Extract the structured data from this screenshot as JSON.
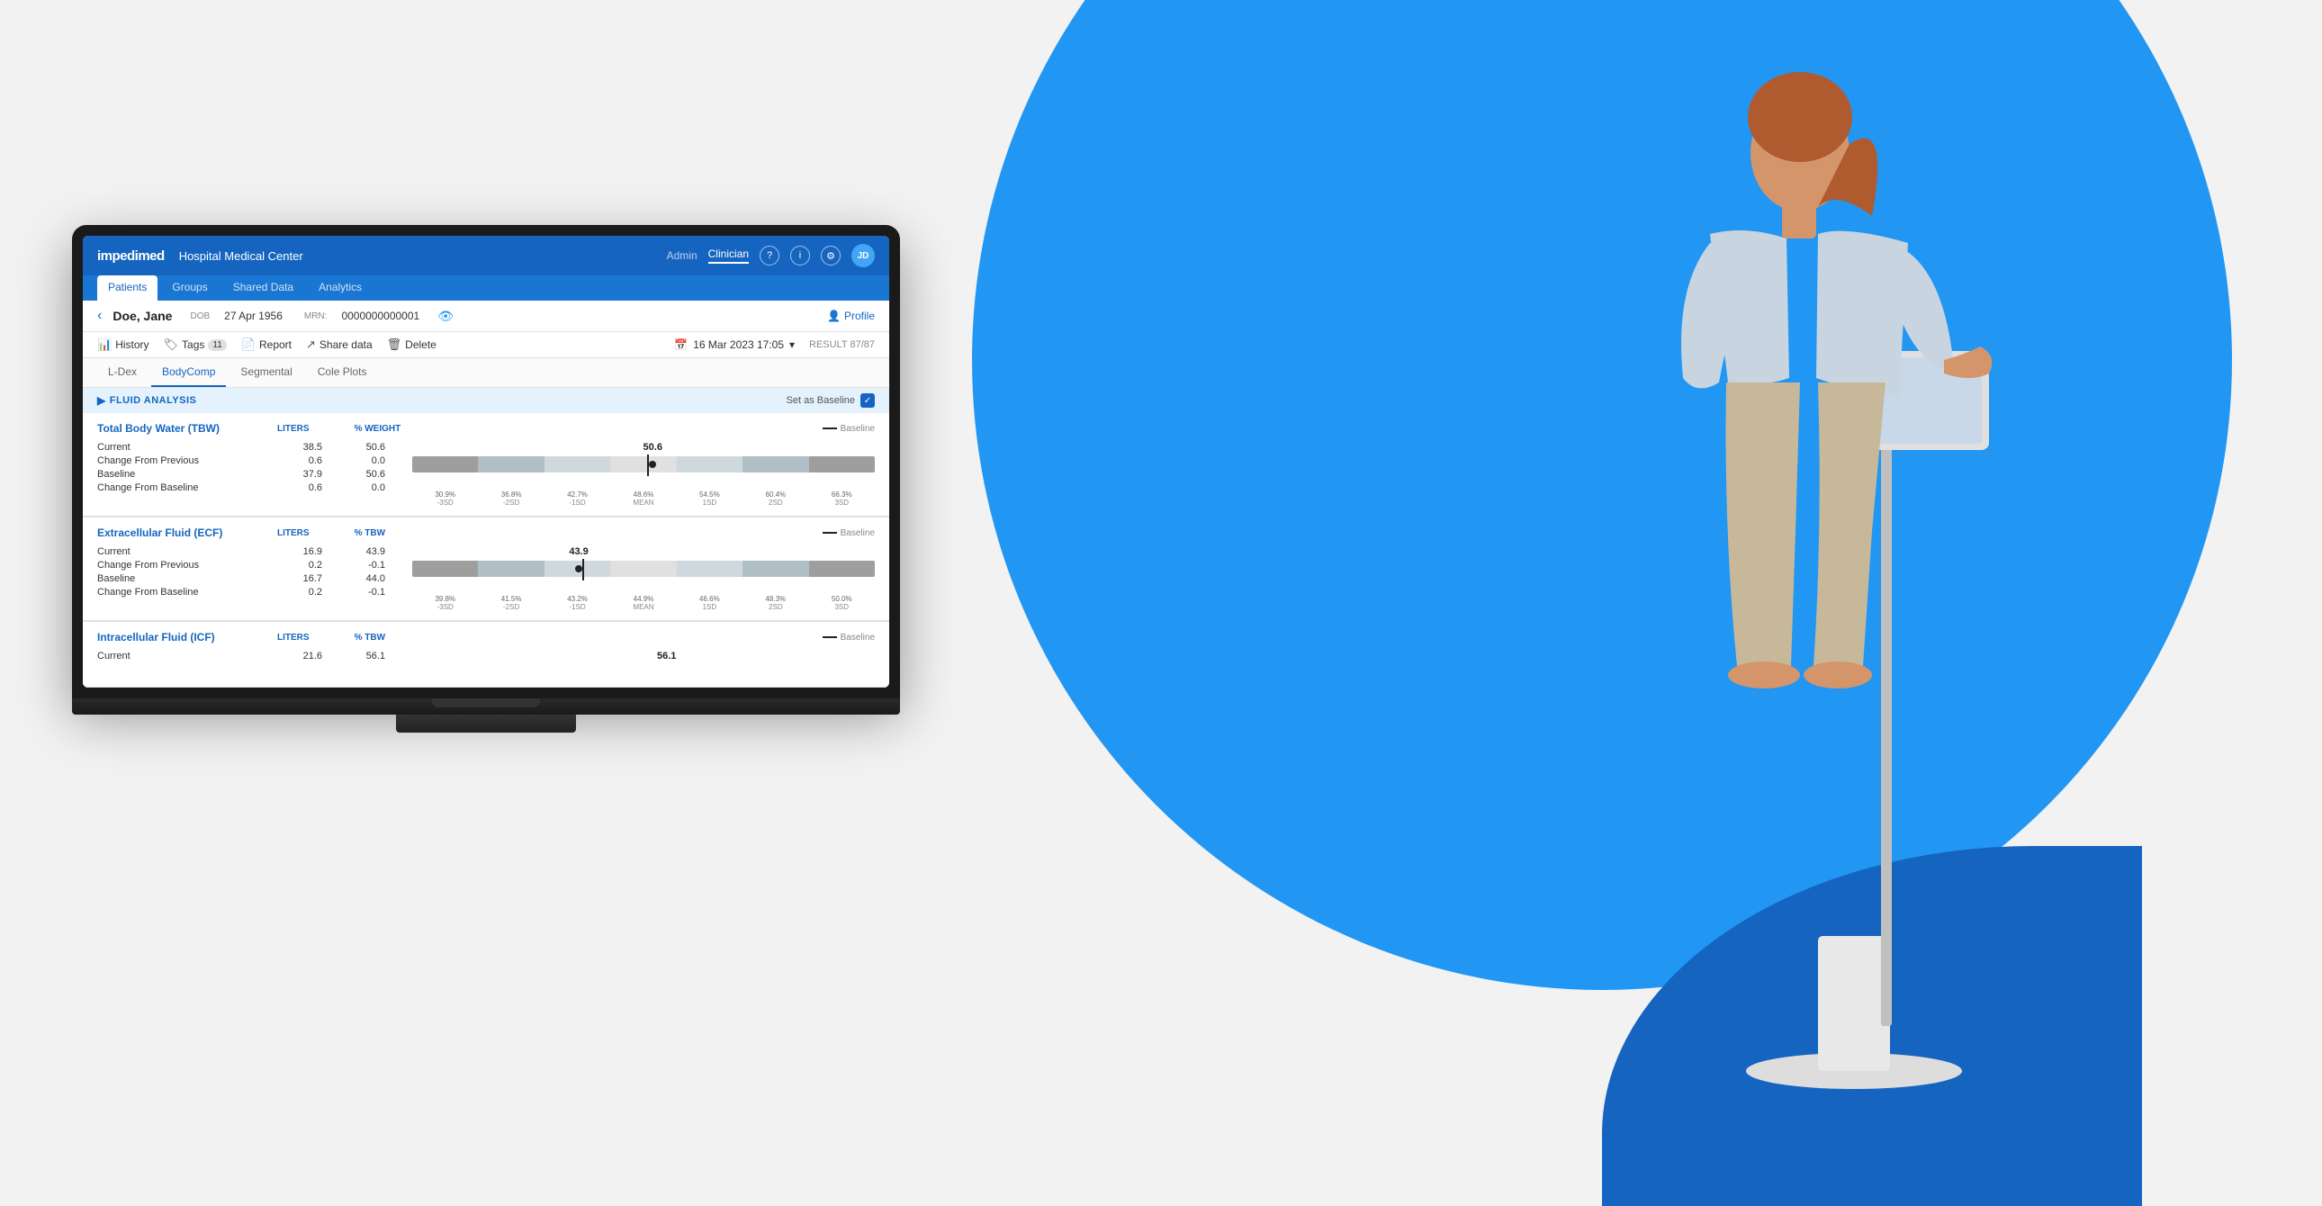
{
  "background": {
    "color": "#f2f2f2",
    "circle_color": "#2196F3",
    "arc_color": "#1a6cc4"
  },
  "app": {
    "logo": "impedimed",
    "hospital": "Hospital Medical Center",
    "nav": {
      "role_admin": "Admin",
      "role_clinician": "Clinician",
      "active_role": "Clinician"
    },
    "tabs": [
      {
        "label": "Patients",
        "active": true
      },
      {
        "label": "Groups",
        "active": false
      },
      {
        "label": "Shared Data",
        "active": false
      },
      {
        "label": "Analytics",
        "active": false
      }
    ],
    "user_initials": "JD"
  },
  "patient": {
    "name": "Doe, Jane",
    "dob_label": "DOB",
    "dob": "27 Apr 1956",
    "mrn_label": "MRN:",
    "mrn": "0000000000001",
    "profile_label": "Profile"
  },
  "actions": {
    "history": "History",
    "tags": "Tags",
    "tags_count": "11",
    "report": "Report",
    "share_data": "Share data",
    "delete": "Delete",
    "date": "16 Mar 2023 17:05",
    "result": "RESULT 87/87"
  },
  "content_tabs": [
    {
      "label": "L-Dex",
      "active": false
    },
    {
      "label": "BodyComp",
      "active": true
    },
    {
      "label": "Segmental",
      "active": false
    },
    {
      "label": "Cole Plots",
      "active": false
    }
  ],
  "fluid_analysis": {
    "section_title": "FLUID ANALYSIS",
    "set_baseline_label": "Set as Baseline",
    "baseline_label": "Baseline",
    "sections": [
      {
        "title": "Total Body Water (TBW)",
        "unit1": "LITERS",
        "unit2": "% WEIGHT",
        "rows": [
          {
            "label": "Current",
            "val1": "38.5",
            "val2": "50.6"
          },
          {
            "label": "Change From Previous",
            "val1": "0.6",
            "val2": "0.0"
          },
          {
            "label": "Baseline",
            "val1": "37.9",
            "val2": "50.6"
          },
          {
            "label": "Change From Baseline",
            "val1": "0.6",
            "val2": "0.0"
          }
        ],
        "chart": {
          "value": "50.6",
          "marker_pct": 52,
          "segments": [
            {
              "color": "#b0bec5",
              "width": 14
            },
            {
              "color": "#b0bec5",
              "width": 14
            },
            {
              "color": "#cfd8dc",
              "width": 14
            },
            {
              "color": "#e0e0e0",
              "width": 15
            },
            {
              "color": "#cfd8dc",
              "width": 15
            },
            {
              "color": "#b0bec5",
              "width": 14
            },
            {
              "color": "#90a4ae",
              "width": 14
            }
          ],
          "labels": [
            {
              "text": "30.9%",
              "sub": "-3SD"
            },
            {
              "text": "36.8%",
              "sub": "-2SD"
            },
            {
              "text": "42.7%",
              "sub": "-1SD"
            },
            {
              "text": "48.6%",
              "sub": "MEAN"
            },
            {
              "text": "54.5%",
              "sub": "1SD"
            },
            {
              "text": "60.4%",
              "sub": "2SD"
            },
            {
              "text": "66.3%",
              "sub": "3SD"
            }
          ]
        }
      },
      {
        "title": "Extracellular Fluid (ECF)",
        "unit1": "LITERS",
        "unit2": "% TBW",
        "rows": [
          {
            "label": "Current",
            "val1": "16.9",
            "val2": "43.9"
          },
          {
            "label": "Change From Previous",
            "val1": "0.2",
            "val2": "-0.1"
          },
          {
            "label": "Baseline",
            "val1": "16.7",
            "val2": "44.0"
          },
          {
            "label": "Change From Baseline",
            "val1": "0.2",
            "val2": "-0.1"
          }
        ],
        "chart": {
          "value": "43.9",
          "marker_pct": 38,
          "segments": [
            {
              "color": "#90a4ae",
              "width": 14
            },
            {
              "color": "#b0bec5",
              "width": 14
            },
            {
              "color": "#cfd8dc",
              "width": 14
            },
            {
              "color": "#e0e0e0",
              "width": 15
            },
            {
              "color": "#cfd8dc",
              "width": 15
            },
            {
              "color": "#b0bec5",
              "width": 14
            },
            {
              "color": "#90a4ae",
              "width": 14
            }
          ],
          "labels": [
            {
              "text": "39.8%",
              "sub": "-3SD"
            },
            {
              "text": "41.5%",
              "sub": "-2SD"
            },
            {
              "text": "43.2%",
              "sub": "-1SD"
            },
            {
              "text": "44.9%",
              "sub": "MEAN"
            },
            {
              "text": "46.6%",
              "sub": "1SD"
            },
            {
              "text": "48.3%",
              "sub": "2SD"
            },
            {
              "text": "50.0%",
              "sub": "3SD"
            }
          ]
        }
      },
      {
        "title": "Intracellular Fluid (ICF)",
        "unit1": "LITERS",
        "unit2": "% TBW",
        "rows": [
          {
            "label": "Current",
            "val1": "21.6",
            "val2": "56.1"
          }
        ],
        "chart": {
          "value": "56.1",
          "marker_pct": 55,
          "segments": [],
          "labels": []
        }
      }
    ]
  }
}
